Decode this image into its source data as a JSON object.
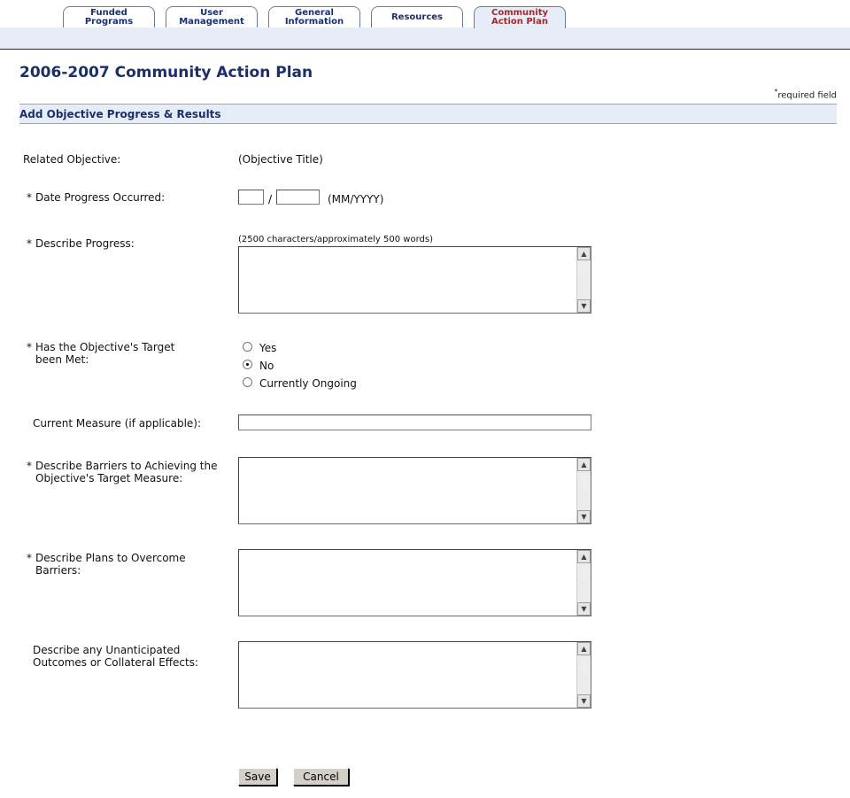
{
  "tabs": [
    {
      "label": "Funded\nPrograms",
      "active": false
    },
    {
      "label": "User\nManagement",
      "active": false
    },
    {
      "label": "General\nInformation",
      "active": false
    },
    {
      "label": "Resources",
      "active": false
    },
    {
      "label": "Community\nAction Plan",
      "active": true
    }
  ],
  "page": {
    "title": "2006-2007 Community Action Plan",
    "required_star": "*",
    "required_note": "required field",
    "section_title": "Add Objective Progress & Results"
  },
  "form": {
    "related_objective": {
      "label": "Related Objective:",
      "value": "(Objective Title)"
    },
    "date_progress": {
      "star": "*",
      "label": "Date Progress Occurred:",
      "slash": "/",
      "format": "(MM/YYYY)",
      "month": "",
      "year": ""
    },
    "describe_progress": {
      "star": "*",
      "label": "Describe Progress:",
      "hint": "(2500 characters/approximately 500 words)"
    },
    "target_met": {
      "star": "*",
      "label_line1": "Has the Objective's Target",
      "label_line2": "been Met:",
      "options": [
        {
          "label": "Yes",
          "checked": false
        },
        {
          "label": "No",
          "checked": true
        },
        {
          "label": "Currently Ongoing",
          "checked": false
        }
      ]
    },
    "current_measure": {
      "label": "Current Measure (if applicable):",
      "value": ""
    },
    "barriers": {
      "star": "*",
      "label_line1": "Describe Barriers to Achieving the",
      "label_line2": "Objective's Target Measure:"
    },
    "plans": {
      "star": "*",
      "label_line1": "Describe Plans to Overcome",
      "label_line2": "Barriers:"
    },
    "unanticipated": {
      "label_line1": "Describe any Unanticipated",
      "label_line2": "Outcomes or Collateral Effects:"
    }
  },
  "buttons": {
    "save": "Save",
    "cancel": "Cancel"
  },
  "icons": {
    "scroll_up": "▲",
    "scroll_down": "▼"
  }
}
